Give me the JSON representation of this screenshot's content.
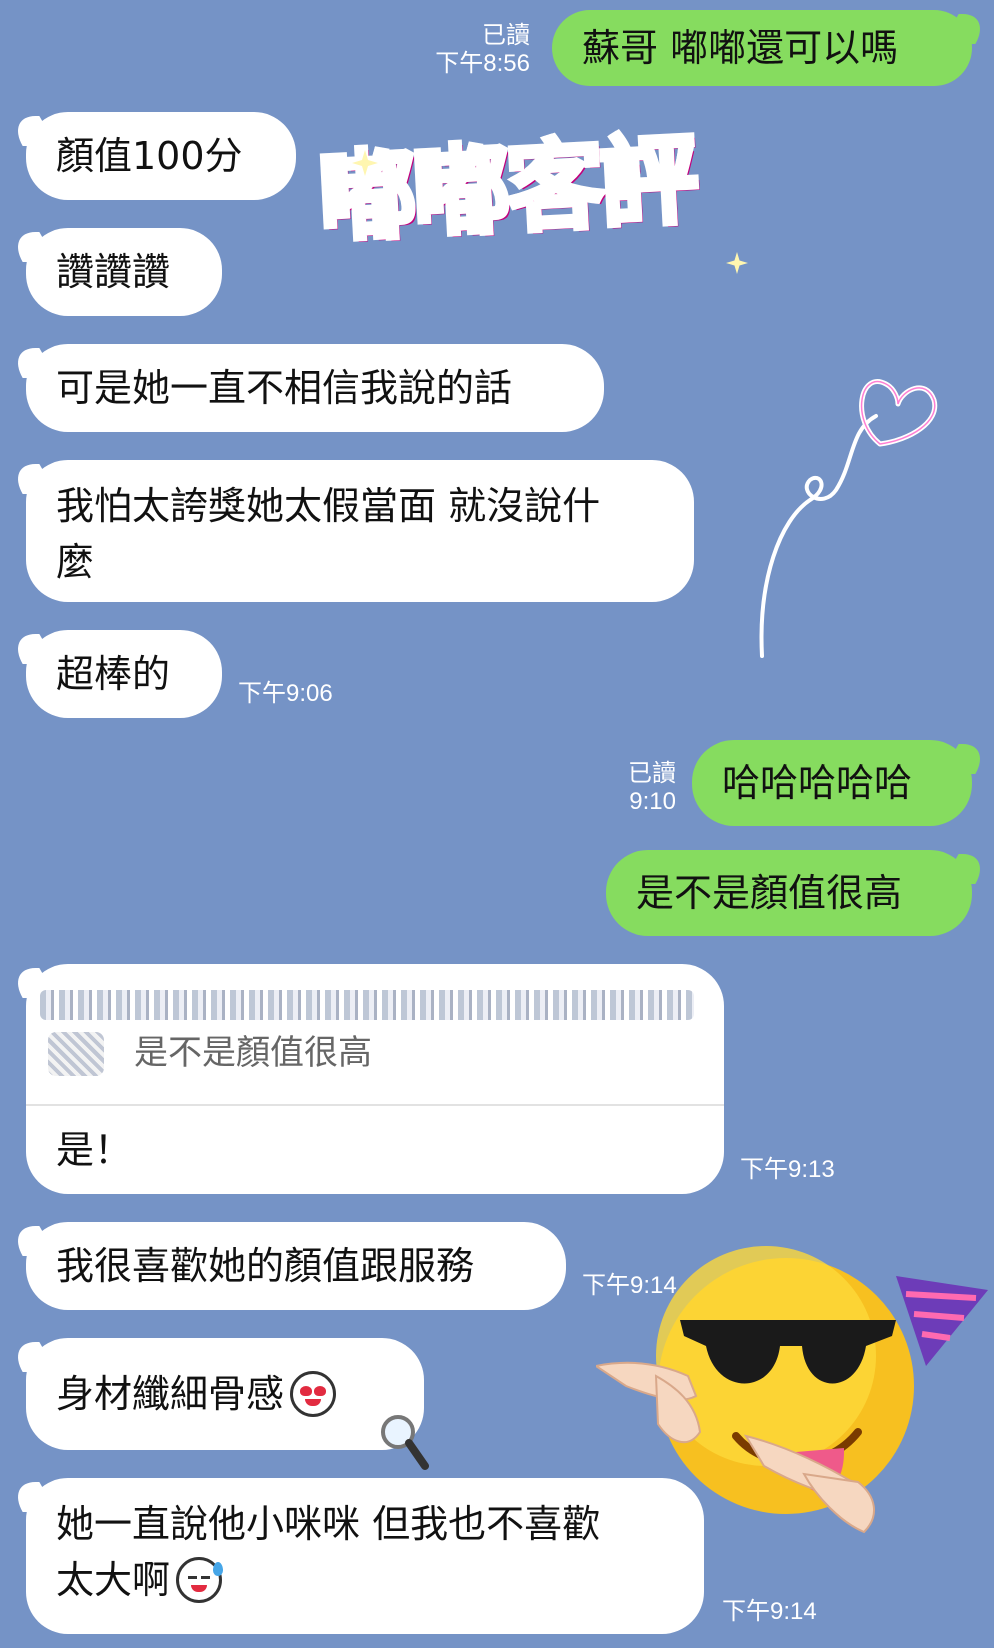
{
  "messages": {
    "m1": {
      "text": "蘇哥 嘟嘟還可以嗎",
      "read": "已讀",
      "time": "下午8:56"
    },
    "m2": {
      "text": "顏值100分"
    },
    "m3": {
      "text": "讚讚讚"
    },
    "m4": {
      "text": "可是她一直不相信我說的話"
    },
    "m5": {
      "line1": "我怕太誇獎她太假當面 就沒說什",
      "line2": "麼"
    },
    "m6": {
      "text": "超棒的",
      "time": "下午9:06"
    },
    "m7": {
      "text": "哈哈哈哈哈",
      "read": "已讀",
      "time": "9:10"
    },
    "m8": {
      "text": "是不是顏值很高"
    },
    "m9": {
      "quote": "是不是顏值很高",
      "text": "是！",
      "time": "下午9:13"
    },
    "m10": {
      "text": "我很喜歡她的顏值跟服務",
      "time": "下午9:14"
    },
    "m11": {
      "text": "身材纖細骨感"
    },
    "m12": {
      "line1": "她一直說他小咪咪 但我也不喜歡",
      "line2": "太大啊",
      "time": "下午9:14"
    }
  },
  "overlay": {
    "stamp_title": "嘟嘟客評"
  },
  "icons": {
    "heart": "heart-doodle-icon",
    "sunglasses_emoji": "sunglasses-party-emoji-icon",
    "heart_eyes_sticker": "heart-eyes-face-icon",
    "sweat_sticker": "sweat-face-icon",
    "magnifier": "magnifier-icon"
  },
  "colors": {
    "background": "#7593c6",
    "incoming": "#ffffff",
    "outgoing": "#86dc5f",
    "stamp": "#ff3fb0"
  }
}
